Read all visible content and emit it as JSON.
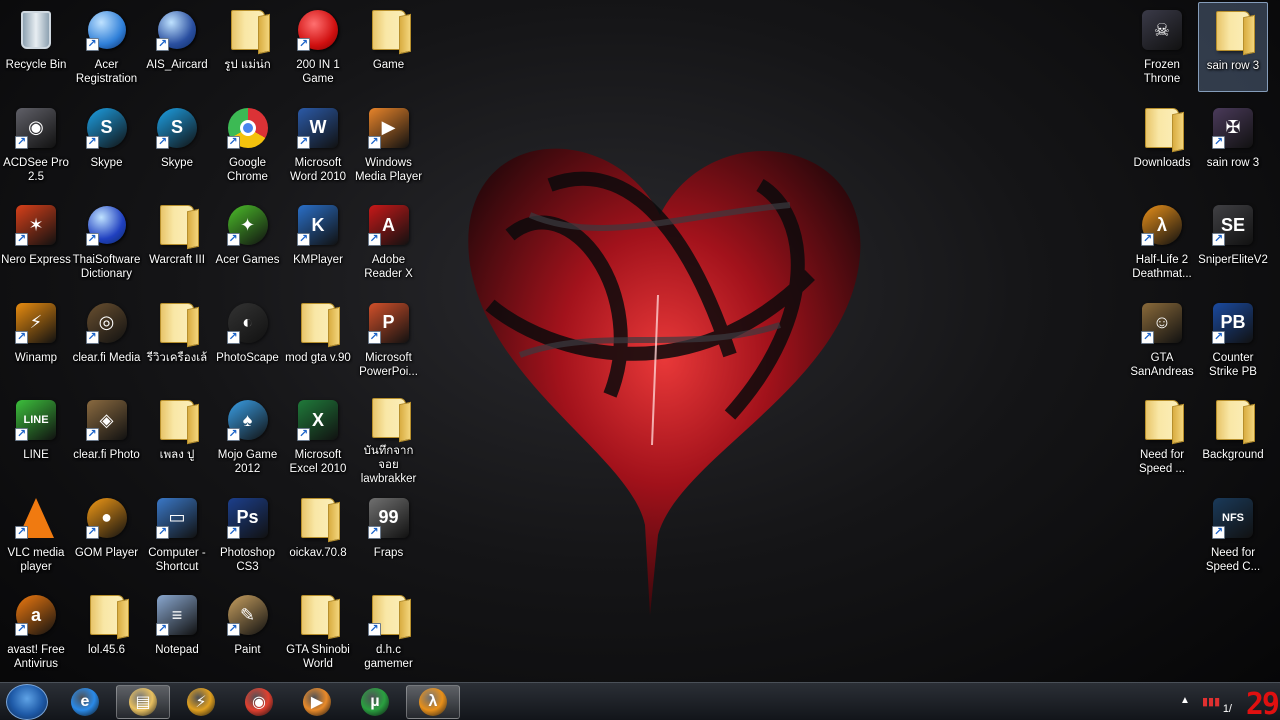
{
  "desktop": {
    "selected_icon": "sain row 3",
    "left_icons": [
      {
        "label": "Recycle Bin",
        "icon": "recycle-bin-icon",
        "kind": "bin",
        "shortcut": false
      },
      {
        "label": "Acer Registration",
        "icon": "globe-icon",
        "kind": "globe",
        "color": "#2f7fd8",
        "shortcut": true
      },
      {
        "label": "AIS_Aircard",
        "icon": "planet-icon",
        "kind": "planet",
        "color": "#2a4fa0",
        "shortcut": true
      },
      {
        "label": "รูป แม่น่ก",
        "icon": "folder-icon",
        "kind": "folder",
        "shortcut": false
      },
      {
        "label": "200 IN 1 Game",
        "icon": "red-ball-icon",
        "kind": "redball",
        "color": "#e02020",
        "shortcut": true
      },
      {
        "label": "Game",
        "icon": "folder-icon",
        "kind": "folder",
        "shortcut": false
      },
      {
        "label": "ACDSee Pro 2.5",
        "icon": "camera-icon",
        "kind": "tile",
        "color": "#606068",
        "glyph": "◉",
        "shortcut": true
      },
      {
        "label": "Skype",
        "icon": "skype-icon",
        "kind": "round",
        "color": "#1da1e6",
        "glyph": "S",
        "shortcut": true
      },
      {
        "label": "Skype",
        "icon": "skype-icon",
        "kind": "round",
        "color": "#1da1e6",
        "glyph": "S",
        "shortcut": true
      },
      {
        "label": "Google Chrome",
        "icon": "chrome-icon",
        "kind": "chrome",
        "shortcut": true
      },
      {
        "label": "Microsoft Word 2010",
        "icon": "word-icon",
        "kind": "tile",
        "color": "#2b5aa8",
        "glyph": "W",
        "shortcut": true
      },
      {
        "label": "Windows Media Player",
        "icon": "media-player-icon",
        "kind": "tile",
        "color": "#e8842a",
        "glyph": "▶",
        "shortcut": true
      },
      {
        "label": "Nero Express",
        "icon": "flame-icon",
        "kind": "tile",
        "color": "#d8401a",
        "glyph": "✶",
        "shortcut": true
      },
      {
        "label": "ThaiSoftware Dictionary",
        "icon": "globe-grid-icon",
        "kind": "globe",
        "color": "#2040c0",
        "shortcut": true
      },
      {
        "label": "Warcraft III",
        "icon": "folder-icon",
        "kind": "folder",
        "shortcut": false
      },
      {
        "label": "Acer Games",
        "icon": "acer-games-icon",
        "kind": "round",
        "color": "#4cbf2a",
        "glyph": "✦",
        "shortcut": true
      },
      {
        "label": "KMPlayer",
        "icon": "kmplayer-icon",
        "kind": "tile",
        "color": "#2a6fc8",
        "glyph": "K",
        "shortcut": true
      },
      {
        "label": "Adobe Reader X",
        "icon": "adobe-reader-icon",
        "kind": "tile",
        "color": "#c81818",
        "glyph": "A",
        "shortcut": true
      },
      {
        "label": "Winamp",
        "icon": "winamp-icon",
        "kind": "tile",
        "color": "#e88c10",
        "glyph": "⚡",
        "shortcut": true
      },
      {
        "label": "clear.fi Media",
        "icon": "speaker-icon",
        "kind": "round",
        "color": "#6a5030",
        "glyph": "◎",
        "shortcut": true
      },
      {
        "label": "รีวิวเครื่องเล้",
        "icon": "folder-icon",
        "kind": "folder",
        "shortcut": false
      },
      {
        "label": "PhotoScape",
        "icon": "photoscape-icon",
        "kind": "round",
        "color": "#333333",
        "glyph": "◐",
        "shortcut": true
      },
      {
        "label": "mod gta v.90",
        "icon": "folder-icon",
        "kind": "folder",
        "shortcut": false
      },
      {
        "label": "Microsoft PowerPoi...",
        "icon": "powerpoint-icon",
        "kind": "tile",
        "color": "#d2502a",
        "glyph": "P",
        "shortcut": true
      },
      {
        "label": "LINE",
        "icon": "line-icon",
        "kind": "tile",
        "color": "#3cc03c",
        "glyph": "LINE",
        "shortcut": true
      },
      {
        "label": "clear.fi Photo",
        "icon": "photo-icon",
        "kind": "tile",
        "color": "#8a6a40",
        "glyph": "◈",
        "shortcut": true
      },
      {
        "label": "เพลง ปู",
        "icon": "folder-icon",
        "kind": "folder",
        "shortcut": false
      },
      {
        "label": "Mojo Game 2012",
        "icon": "mushroom-icon",
        "kind": "round",
        "color": "#3aa0e8",
        "glyph": "♠",
        "shortcut": true
      },
      {
        "label": "Microsoft Excel 2010",
        "icon": "excel-icon",
        "kind": "tile",
        "color": "#1f7a3a",
        "glyph": "X",
        "shortcut": true
      },
      {
        "label": "บันทึกจาก จอย lawbrakker",
        "icon": "folder-icon",
        "kind": "folder",
        "shortcut": false
      },
      {
        "label": "VLC media player",
        "icon": "vlc-cone-icon",
        "kind": "cone",
        "shortcut": true
      },
      {
        "label": "GOM Player",
        "icon": "gom-player-icon",
        "kind": "round",
        "color": "#f39a16",
        "glyph": "●",
        "shortcut": true
      },
      {
        "label": "Computer - Shortcut",
        "icon": "computer-icon",
        "kind": "tile",
        "color": "#3a78c8",
        "glyph": "▭",
        "shortcut": true
      },
      {
        "label": "Photoshop CS3",
        "icon": "photoshop-icon",
        "kind": "tile",
        "color": "#1c3f8c",
        "glyph": "Ps",
        "shortcut": true
      },
      {
        "label": "oickav.70.8",
        "icon": "folder-icon",
        "kind": "folder",
        "shortcut": false
      },
      {
        "label": "Fraps",
        "icon": "fraps-icon",
        "kind": "tile",
        "color": "#707070",
        "glyph": "99",
        "shortcut": true
      },
      {
        "label": "avast! Free Antivirus",
        "icon": "avast-icon",
        "kind": "round",
        "color": "#f07a10",
        "glyph": "a",
        "shortcut": true
      },
      {
        "label": "lol.45.6",
        "icon": "folder-icon",
        "kind": "folder",
        "shortcut": false
      },
      {
        "label": "Notepad",
        "icon": "notepad-icon",
        "kind": "tile",
        "color": "#8aa8d0",
        "glyph": "≡",
        "shortcut": true
      },
      {
        "label": "Paint",
        "icon": "paint-palette-icon",
        "kind": "round",
        "color": "#c8a060",
        "glyph": "✎",
        "shortcut": true
      },
      {
        "label": "GTA Shinobi World",
        "icon": "folder-icon",
        "kind": "folder",
        "shortcut": false
      },
      {
        "label": "d.h.c gamemer",
        "icon": "folder-user-icon",
        "kind": "folder",
        "shortcut": true
      }
    ],
    "right_icons": [
      {
        "label": "Frozen Throne",
        "icon": "frozen-throne-icon",
        "kind": "tile",
        "color": "#3a3a48",
        "glyph": "☠",
        "shortcut": false,
        "col": 0,
        "row": 0
      },
      {
        "label": "sain row 3",
        "icon": "folder-icon",
        "kind": "folder",
        "shortcut": false,
        "col": 1,
        "row": 0
      },
      {
        "label": "Downloads",
        "icon": "folder-icon",
        "kind": "folder",
        "shortcut": false,
        "col": 0,
        "row": 1
      },
      {
        "label": "sain row 3",
        "icon": "saints-row-icon",
        "kind": "tile",
        "color": "#4a3a5a",
        "glyph": "✠",
        "shortcut": true,
        "col": 1,
        "row": 1
      },
      {
        "label": "Half-Life 2 Deathmat...",
        "icon": "half-life-icon",
        "kind": "round",
        "color": "#e8901a",
        "glyph": "λ",
        "shortcut": true,
        "col": 0,
        "row": 2
      },
      {
        "label": "SniperEliteV2",
        "icon": "sniper-elite-icon",
        "kind": "tile",
        "color": "#404044",
        "glyph": "SE",
        "shortcut": true,
        "col": 1,
        "row": 2
      },
      {
        "label": "GTA SanAndreas",
        "icon": "gta-icon",
        "kind": "tile",
        "color": "#8a6a3a",
        "glyph": "☺",
        "shortcut": true,
        "col": 0,
        "row": 3
      },
      {
        "label": "Counter Strike PB",
        "icon": "point-blank-icon",
        "kind": "tile",
        "color": "#1a4aa0",
        "glyph": "PB",
        "shortcut": true,
        "col": 1,
        "row": 3
      },
      {
        "label": "Need for Speed ...",
        "icon": "folder-icon",
        "kind": "folder",
        "shortcut": false,
        "col": 0,
        "row": 4
      },
      {
        "label": "Background",
        "icon": "folder-icon",
        "kind": "folder",
        "shortcut": false,
        "col": 1,
        "row": 4
      },
      {
        "label": "Need for Speed C...",
        "icon": "nfs-icon",
        "kind": "tile",
        "color": "#1a3a5a",
        "glyph": "NFS",
        "shortcut": true,
        "col": 1,
        "row": 5
      }
    ]
  },
  "taskbar": {
    "items": [
      {
        "name": "internet-explorer-icon",
        "glyph": "e",
        "color": "#2a8ae8",
        "active": false
      },
      {
        "name": "windows-explorer-icon",
        "glyph": "▤",
        "color": "#e8c060",
        "active": true
      },
      {
        "name": "winamp-icon",
        "glyph": "⚡",
        "color": "#e0a020",
        "active": false
      },
      {
        "name": "chrome-icon",
        "glyph": "◉",
        "color": "#e04030",
        "active": false
      },
      {
        "name": "media-player-icon",
        "glyph": "▶",
        "color": "#e88a2a",
        "active": false
      },
      {
        "name": "utorrent-icon",
        "glyph": "µ",
        "color": "#2aa040",
        "active": false
      },
      {
        "name": "half-life-icon",
        "glyph": "λ",
        "color": "#e8901a",
        "active": true
      }
    ],
    "tray": {
      "clock": "1/",
      "overlay_number": "29"
    }
  }
}
